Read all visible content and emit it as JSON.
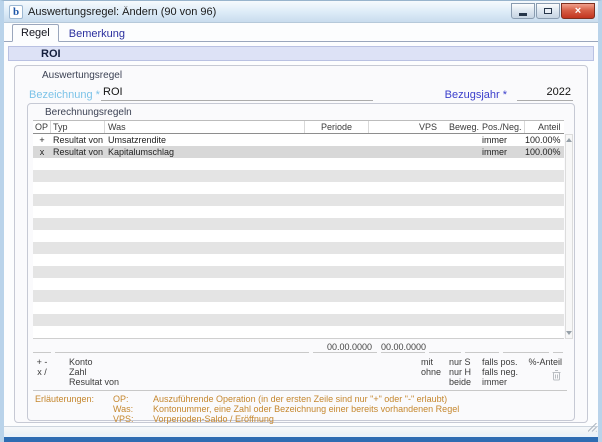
{
  "window": {
    "title": "Auswertungsregel: Ändern (90 von 96)",
    "app_icon_letter": "b",
    "controls": {
      "close_glyph": "×"
    }
  },
  "tabs": [
    {
      "label": "Regel",
      "active": true
    },
    {
      "label": "Bemerkung",
      "active": false
    }
  ],
  "record_header": {
    "title": "ROI"
  },
  "form": {
    "group_title": "Auswertungsregel",
    "bezeichnung": {
      "label": "Bezeichnung *",
      "value": "ROI"
    },
    "bezugsjahr": {
      "label": "Bezugsjahr *",
      "value": "2022"
    }
  },
  "rules": {
    "group_title": "Berechnungsregeln",
    "columns": [
      "OP",
      "Typ",
      "Was",
      "Periode",
      "",
      "VPS",
      "Beweg.",
      "Pos./Neg.",
      "Anteil"
    ],
    "rows": [
      {
        "op": "+",
        "typ": "Resultat von",
        "was": "Umsatzrendite",
        "periode1": "",
        "periode2": "",
        "vps": "",
        "beweg": "",
        "posneg": "immer",
        "anteil": "100.00%"
      },
      {
        "op": "x",
        "typ": "Resultat von",
        "was": "Kapitalumschlag",
        "periode1": "",
        "periode2": "",
        "vps": "",
        "beweg": "",
        "posneg": "immer",
        "anteil": "100.00%"
      }
    ],
    "empty_row_count": 15,
    "edit_row": {
      "periode1": "00.00.0000",
      "periode2": "00.00.0000"
    },
    "legend": {
      "op_lines": [
        "+ -",
        "x /"
      ],
      "was_lines": [
        "Konto",
        "Zahl",
        "Resultat von"
      ],
      "vps_lines": [
        "mit",
        "ohne"
      ],
      "beweg_lines": [
        "nur S",
        "nur H",
        "beide"
      ],
      "posneg_lines": [
        "falls pos.",
        "falls neg.",
        "immer"
      ],
      "anteil_label": "%-Anteil"
    }
  },
  "notes": {
    "label": "Erläuterungen:",
    "items": [
      {
        "key": "OP:",
        "text": "Auszuführende Operation (in der ersten Zeile sind nur \"+\" oder \"-\" erlaubt)"
      },
      {
        "key": "Was:",
        "text": "Kontonummer, eine Zahl oder Bezeichnung einer bereits vorhandenen Regel"
      },
      {
        "key": "VPS:",
        "text": "Vorperioden-Saldo / Eröffnung"
      }
    ]
  },
  "colors": {
    "bezeichnung_label": "#7cc3e8",
    "bezugsjahr_label": "#3a3ecb",
    "notes_text": "#c5872e",
    "close_button_red": "#c23520",
    "frame_blue": "#2e6cb2",
    "selected_row_bg": "#d8d8d8",
    "stripe_bg": "#e4e4e4",
    "record_header_bg": "#dde2f6"
  }
}
